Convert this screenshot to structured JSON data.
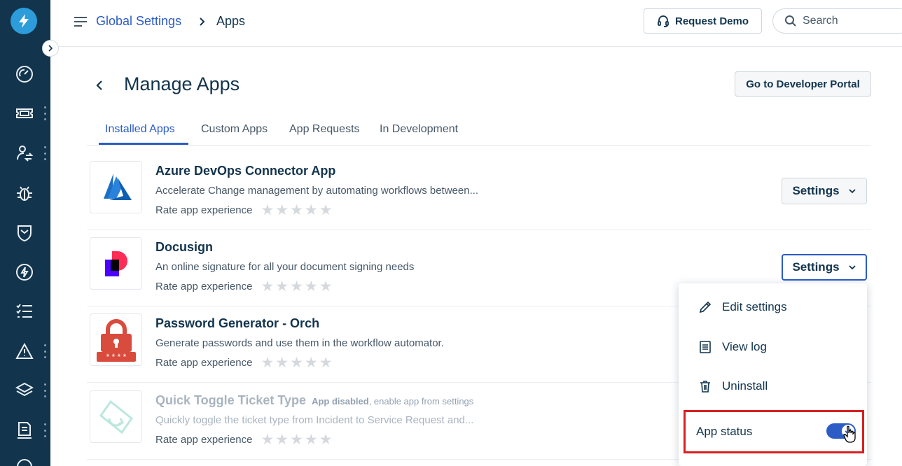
{
  "header": {
    "breadcrumb_link": "Global Settings",
    "breadcrumb_current": "Apps",
    "request_demo_label": "Request Demo",
    "search_placeholder": "Search"
  },
  "page": {
    "title": "Manage Apps",
    "developer_portal_label": "Go to Developer Portal"
  },
  "tabs": [
    {
      "label": "Installed Apps",
      "active": true
    },
    {
      "label": "Custom Apps",
      "active": false
    },
    {
      "label": "App Requests",
      "active": false
    },
    {
      "label": "In Development",
      "active": false
    }
  ],
  "apps": [
    {
      "name": "Azure DevOps Connector App",
      "description": "Accelerate Change management by automating workflows between...",
      "rate_label": "Rate app experience",
      "rating": 0,
      "settings_label": "Settings",
      "icon": "azure-logo"
    },
    {
      "name": "Docusign",
      "description": "An online signature for all your document signing needs",
      "rate_label": "Rate app experience",
      "rating": 0,
      "settings_label": "Settings",
      "icon": "docusign-logo"
    },
    {
      "name": "Password Generator - Orch",
      "description": "Generate passwords and use them in the workflow automator.",
      "rate_label": "Rate app experience",
      "rating": 0,
      "icon": "lock-logo"
    },
    {
      "name": "Quick Toggle Ticket Type",
      "description": "Quickly toggle the ticket type from Incident to Service Request and...",
      "rate_label": "Rate app experience",
      "rating": 0,
      "disabled_note_bold": "App disabled",
      "disabled_note_rest": ", enable app from settings",
      "icon": "ticket-toggle-logo"
    }
  ],
  "settings_menu": {
    "items": [
      {
        "label": "Edit settings",
        "icon": "pencil-icon"
      },
      {
        "label": "View log",
        "icon": "log-icon"
      },
      {
        "label": "Uninstall",
        "icon": "trash-icon"
      }
    ],
    "app_status_label": "App status",
    "app_status_on": true
  },
  "sidebar_icons": [
    "dashboard-icon",
    "ticket-icon",
    "user-exchange-icon",
    "bug-icon",
    "shield-icon",
    "lightning-icon",
    "checklist-icon",
    "warning-icon",
    "layers-icon",
    "report-icon"
  ],
  "colors": {
    "sidebar": "#12344d",
    "accent": "#2c5cc5",
    "highlight": "#d92020"
  }
}
